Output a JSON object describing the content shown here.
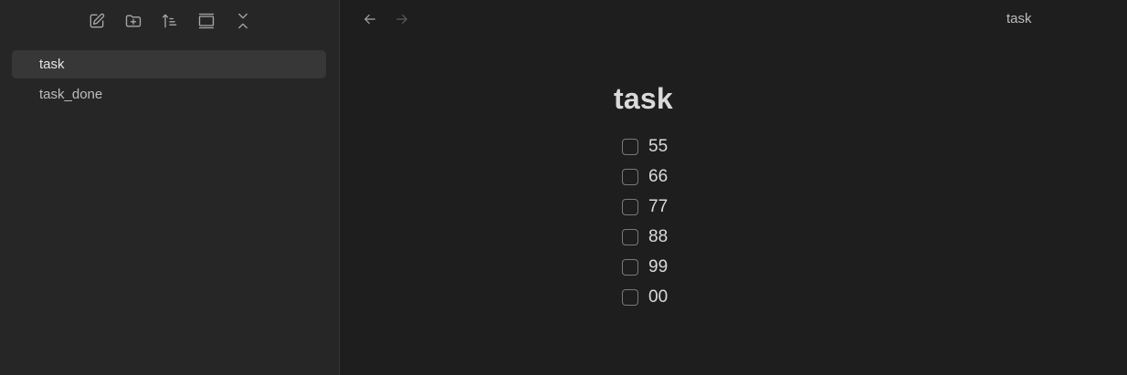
{
  "sidebar": {
    "toolbar": {
      "icons": [
        "new-note-icon",
        "new-folder-icon",
        "sort-icon",
        "layout-icon",
        "collapse-icon"
      ]
    },
    "files": [
      {
        "label": "task",
        "active": true
      },
      {
        "label": "task_done",
        "active": false
      }
    ]
  },
  "topbar": {
    "tab_title": "task"
  },
  "note": {
    "title": "task",
    "tasks": [
      {
        "text": "55",
        "checked": false
      },
      {
        "text": "66",
        "checked": false
      },
      {
        "text": "77",
        "checked": false
      },
      {
        "text": "88",
        "checked": false
      },
      {
        "text": "99",
        "checked": false
      },
      {
        "text": "00",
        "checked": false
      }
    ]
  }
}
